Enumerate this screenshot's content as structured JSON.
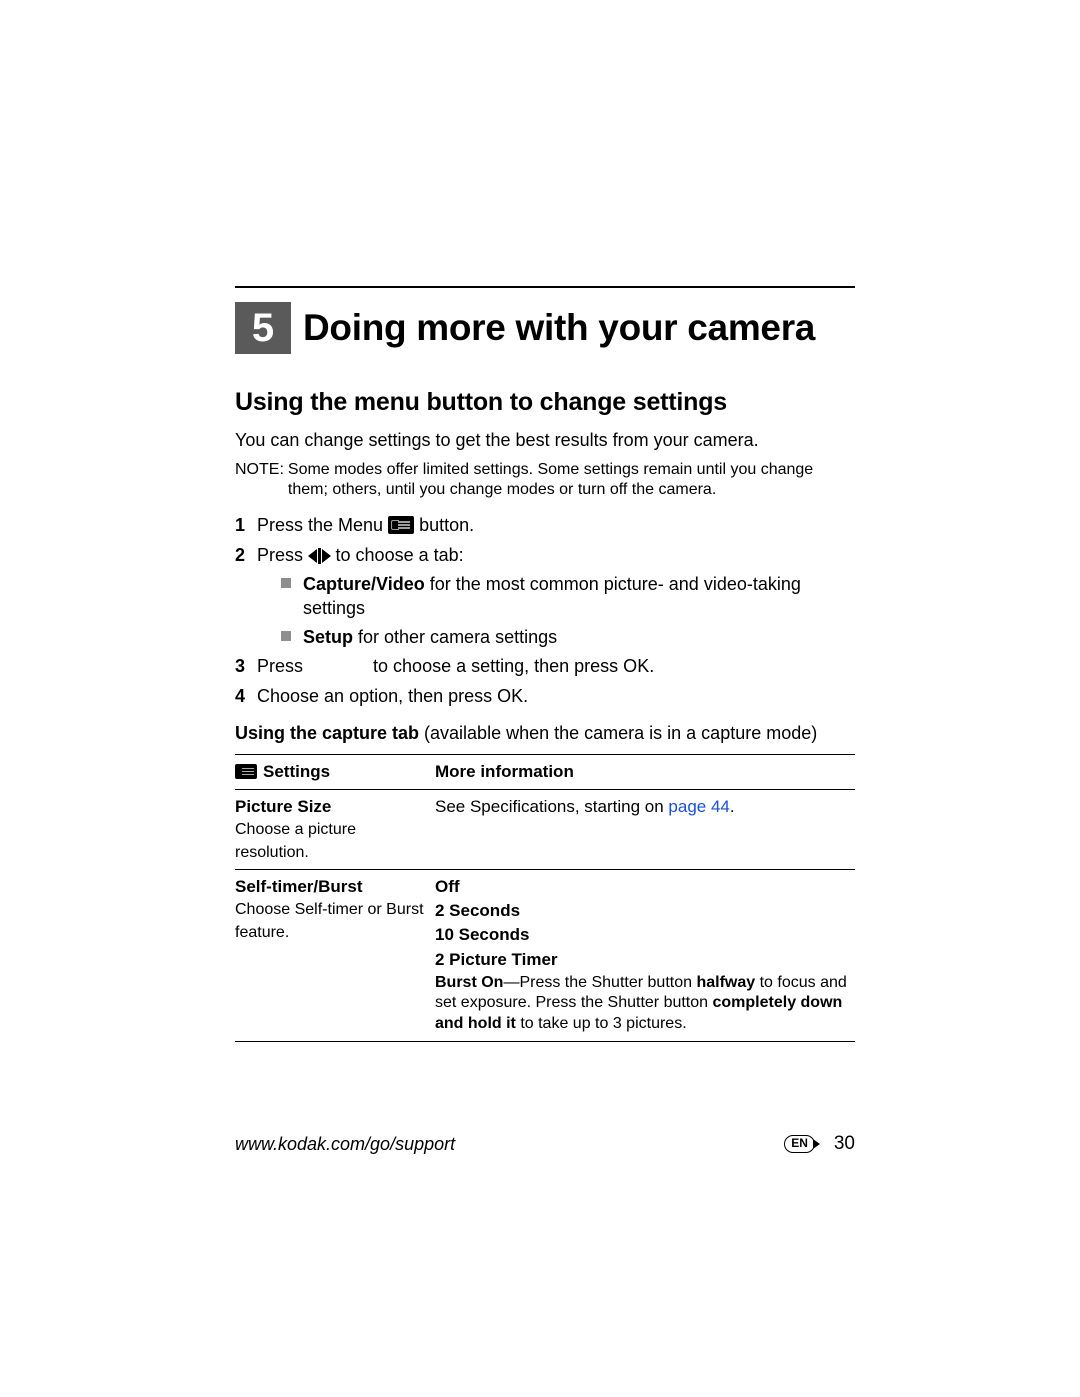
{
  "chapter": {
    "number": "5",
    "title": "Doing more with your camera"
  },
  "section": {
    "title": "Using the menu button to change settings"
  },
  "intro": "You can change settings to get the best results from your camera.",
  "note": {
    "label": "NOTE:",
    "text": "Some modes offer limited settings. Some settings remain until you change them; others, until you change modes or turn off the camera."
  },
  "steps": {
    "s1": {
      "num": "1",
      "a": "Press the Menu ",
      "b": " button."
    },
    "s2": {
      "num": "2",
      "a": "Press ",
      "b": " to choose a tab:"
    },
    "bullets": {
      "cv": {
        "bold": "Capture/Video",
        "rest": " for the most common picture- and video-taking settings"
      },
      "setup": {
        "bold": "Setup",
        "rest": " for other camera settings"
      }
    },
    "s3": {
      "num": "3",
      "a": "Press ",
      "gap": "            ",
      "b": " to choose a setting, then press OK."
    },
    "s4": {
      "num": "4",
      "text": "Choose an option, then press OK."
    }
  },
  "subhead": {
    "bold": "Using the capture tab",
    "rest": " (available when the camera is in a capture mode)"
  },
  "table": {
    "headers": {
      "settings": "Settings",
      "info": "More information"
    },
    "row1": {
      "title": "Picture Size",
      "sub": "Choose a picture resolution.",
      "info_a": "See Specifications, starting on ",
      "info_link": "page 44",
      "info_b": "."
    },
    "row2": {
      "title": "Self-timer/Burst",
      "sub": "Choose Self-timer or Burst feature.",
      "opts": {
        "off": "Off",
        "s2": "2 Seconds",
        "s10": "10 Seconds",
        "pt": "2 Picture Timer"
      },
      "burst": {
        "lead_bold": "Burst On",
        "a": "—Press the Shutter button ",
        "b_bold": "halfway",
        "c": " to focus and set exposure. Press the Shutter button ",
        "d_bold": "completely down and hold it",
        "e": " to take up to 3 pictures."
      }
    }
  },
  "footer": {
    "url": "www.kodak.com/go/support",
    "lang": "EN",
    "page": "30"
  }
}
